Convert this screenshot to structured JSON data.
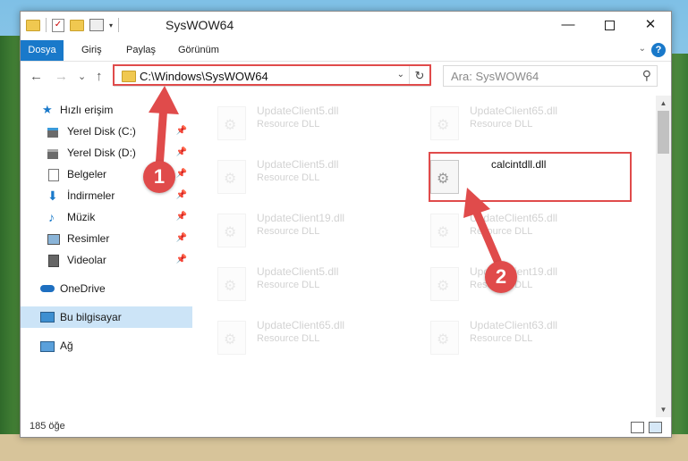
{
  "window": {
    "title": "SysWOW64",
    "controls": {
      "minimize": "—",
      "maximize": "",
      "close": "✕"
    }
  },
  "ribbon": {
    "tabs": [
      "Dosya",
      "Giriş",
      "Paylaş",
      "Görünüm"
    ],
    "help": "?",
    "expand": "⌄"
  },
  "navbar": {
    "back": "←",
    "forward": "→",
    "recent": "⌄",
    "up": "↑",
    "address": "C:\\Windows\\SysWOW64",
    "address_dropdown": "⌄",
    "refresh": "↻",
    "search_placeholder": "Ara: SysWOW64",
    "search_icon": "⚲"
  },
  "sidebar": {
    "items": [
      {
        "label": "Hızlı erişim",
        "icon": "star-icon",
        "pinned": false
      },
      {
        "label": "Yerel Disk (C:)",
        "icon": "drive-icon",
        "pinned": true
      },
      {
        "label": "Yerel Disk (D:)",
        "icon": "drive-icon",
        "pinned": true
      },
      {
        "label": "Belgeler",
        "icon": "documents-icon",
        "pinned": true
      },
      {
        "label": "İndirmeler",
        "icon": "downloads-icon",
        "pinned": true
      },
      {
        "label": "Müzik",
        "icon": "music-icon",
        "pinned": true
      },
      {
        "label": "Resimler",
        "icon": "pictures-icon",
        "pinned": true
      },
      {
        "label": "Videolar",
        "icon": "videos-icon",
        "pinned": true
      },
      {
        "label": "OneDrive",
        "icon": "onedrive-icon",
        "pinned": false
      },
      {
        "label": "Bu bilgisayar",
        "icon": "this-pc-icon",
        "pinned": false,
        "selected": true
      },
      {
        "label": "Ağ",
        "icon": "network-icon",
        "pinned": false
      }
    ],
    "pin_glyph": "📌"
  },
  "files": [
    {
      "name": "UpdateClient5.dll",
      "type": "Resource DLL",
      "highlighted": false
    },
    {
      "name": "UpdateClient65.dll",
      "type": "Resource DLL",
      "highlighted": false
    },
    {
      "name": "UpdateClient5.dll",
      "type": "Resource DLL",
      "highlighted": false
    },
    {
      "name": "calcintdll.dll",
      "type": "",
      "highlighted": true
    },
    {
      "name": "UpdateClient19.dll",
      "type": "Resource DLL",
      "highlighted": false
    },
    {
      "name": "UpdateClient65.dll",
      "type": "Resource DLL",
      "highlighted": false
    },
    {
      "name": "UpdateClient5.dll",
      "type": "Resource DLL",
      "highlighted": false
    },
    {
      "name": "UpdateClient19.dll",
      "type": "Resource DLL",
      "highlighted": false
    },
    {
      "name": "UpdateClient65.dll",
      "type": "Resource DLL",
      "highlighted": false
    },
    {
      "name": "UpdateClient63.dll",
      "type": "Resource DLL",
      "highlighted": false
    }
  ],
  "status": {
    "count": "185 öğe"
  },
  "callouts": [
    "1",
    "2"
  ],
  "colors": {
    "accent": "#1979ca",
    "highlight": "#e04b4b",
    "selected_bg": "#cce4f7"
  }
}
